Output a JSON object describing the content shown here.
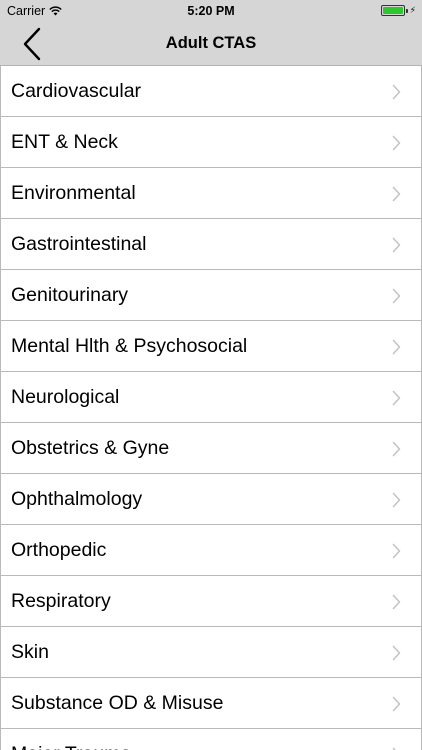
{
  "status_bar": {
    "carrier": "Carrier",
    "time": "5:20 PM",
    "battery_level": 1.0,
    "battery_color": "#2ec82e"
  },
  "nav": {
    "title": "Adult CTAS",
    "back_icon": "chevron-left-icon"
  },
  "list": {
    "items": [
      {
        "label": "Cardiovascular"
      },
      {
        "label": "ENT & Neck"
      },
      {
        "label": "Environmental"
      },
      {
        "label": "Gastrointestinal"
      },
      {
        "label": "Genitourinary"
      },
      {
        "label": "Mental Hlth & Psychosocial"
      },
      {
        "label": "Neurological"
      },
      {
        "label": "Obstetrics & Gyne"
      },
      {
        "label": "Ophthalmology"
      },
      {
        "label": "Orthopedic"
      },
      {
        "label": "Respiratory"
      },
      {
        "label": "Skin"
      },
      {
        "label": "Substance OD & Misuse"
      },
      {
        "label": "Major Trauma"
      }
    ],
    "chevron_icon": "chevron-right-icon"
  },
  "colors": {
    "header_bg": "#d6d6d6",
    "separator": "#b9b9b9",
    "chevron": "#c4c4c9"
  }
}
